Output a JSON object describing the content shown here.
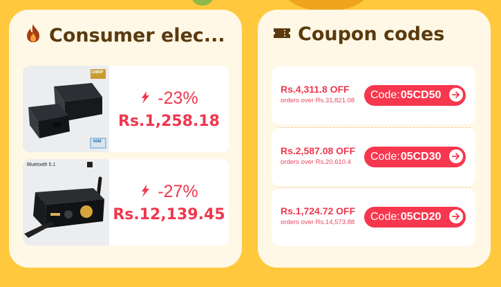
{
  "consumer": {
    "title": "Consumer elec...",
    "items": [
      {
        "discount": "-23%",
        "price": "Rs.1,258.18",
        "badge_top": "1080P",
        "badge_bottom": "60M"
      },
      {
        "discount": "-27%",
        "price": "Rs.12,139.45",
        "badge_top": "Bluetooth 5.1"
      }
    ]
  },
  "coupons": {
    "title": "Coupon codes",
    "items": [
      {
        "off": "Rs.4,311.8 OFF",
        "min": "orders over Rs.31,821.08",
        "code_label": "Code:",
        "code": "05CD50"
      },
      {
        "off": "Rs.2,587.08 OFF",
        "min": "orders over Rs.20,610.4",
        "code_label": "Code:",
        "code": "05CD30"
      },
      {
        "off": "Rs.1,724.72 OFF",
        "min": "orders over Rs.14,573.88",
        "code_label": "Code:",
        "code": "05CD20"
      }
    ]
  },
  "colors": {
    "background": "#ffc83d",
    "card": "#fff8e6",
    "accent": "#f0374e",
    "title": "#5a3a0e"
  },
  "icons": [
    "fire-icon",
    "ticket-icon",
    "down-arrow-icon",
    "arrow-right-icon"
  ]
}
